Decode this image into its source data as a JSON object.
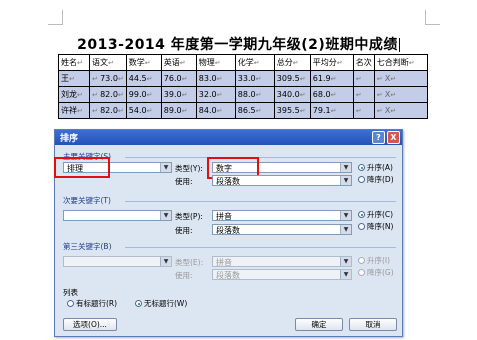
{
  "document": {
    "title": "2013-2014 年度第一学期九年级(2)班期中成绩",
    "table": {
      "headers": [
        "姓名",
        "语文",
        "数学",
        "英语",
        "物理",
        "化学",
        "总分",
        "平均分",
        "名次",
        "七合判断"
      ],
      "rows": [
        [
          "王",
          "73.0",
          "44.5",
          "76.0",
          "83.0",
          "33.0",
          "309.5",
          "61.9",
          "",
          "X"
        ],
        [
          "刘龙",
          "82.0",
          "99.0",
          "39.0",
          "32.0",
          "88.0",
          "340.0",
          "68.0",
          "",
          "X"
        ],
        [
          "许祥",
          "82.0",
          "54.0",
          "89.0",
          "84.0",
          "86.5",
          "395.5",
          "79.1",
          "",
          "X"
        ]
      ]
    }
  },
  "dialog": {
    "title": "排序",
    "help": "?",
    "close": "X",
    "primary": {
      "label": "主要关键字(S)",
      "field": "排理",
      "type_label": "类型(Y):",
      "type": "数字",
      "using_label": "使用:",
      "using": "段落数",
      "asc": "升序(A)",
      "desc": "降序(D)"
    },
    "secondary": {
      "label": "次要关键字(T)",
      "field": "",
      "type_label": "类型(P):",
      "type": "拼音",
      "using_label": "使用:",
      "using": "段落数",
      "asc": "升序(C)",
      "desc": "降序(N)"
    },
    "tertiary": {
      "label": "第三关键字(B)",
      "field": "",
      "type_label": "类型(E):",
      "type": "拼音",
      "using_label": "使用:",
      "using": "段落数",
      "asc": "升序(I)",
      "desc": "降序(G)"
    },
    "list": {
      "label": "列表",
      "has_header": "有标题行(R)",
      "no_header": "无标题行(W)"
    },
    "buttons": {
      "options": "选项(O)...",
      "ok": "确定",
      "cancel": "取消"
    }
  },
  "colors": {
    "highlight": "#e01010",
    "titlebar": "#2453b8",
    "dialog_bg": "#dce6f3",
    "selected_row": "#c3cde8"
  }
}
